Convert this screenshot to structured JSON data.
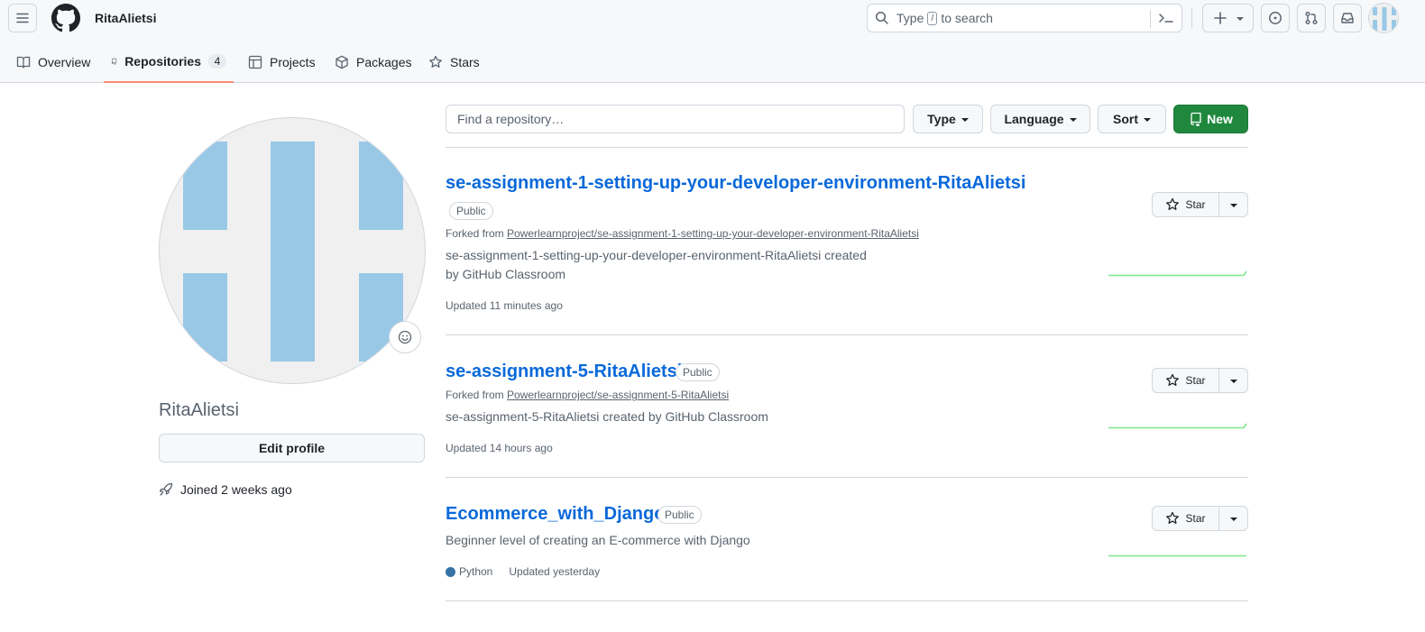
{
  "header": {
    "username": "RitaAlietsi",
    "search": {
      "prefix": "Type",
      "key": "/",
      "suffix": "to search"
    }
  },
  "tabs": [
    {
      "label": "Overview"
    },
    {
      "label": "Repositories",
      "count": "4"
    },
    {
      "label": "Projects"
    },
    {
      "label": "Packages"
    },
    {
      "label": "Stars"
    }
  ],
  "profile": {
    "name": "RitaAlietsi",
    "edit_label": "Edit profile",
    "joined": "Joined 2 weeks ago"
  },
  "toolbar": {
    "filter_placeholder": "Find a repository…",
    "type_label": "Type",
    "language_label": "Language",
    "sort_label": "Sort",
    "new_label": "New"
  },
  "repos": [
    {
      "name": "se-assignment-1-setting-up-your-developer-environment-RitaAlietsi",
      "visibility": "Public",
      "forked_prefix": "Forked from",
      "forked_from": "Powerlearnproject/se-assignment-1-setting-up-your-developer-environment-RitaAlietsi",
      "description_line1": "se-assignment-1-setting-up-your-developer-environment-RitaAlietsi created",
      "description_line2": "by GitHub Classroom",
      "updated": "Updated 11 minutes ago",
      "star_label": "Star"
    },
    {
      "name": "se-assignment-5-RitaAlietsi",
      "visibility": "Public",
      "forked_prefix": "Forked from",
      "forked_from": "Powerlearnproject/se-assignment-5-RitaAlietsi",
      "description_line1": "se-assignment-5-RitaAlietsi created by GitHub Classroom",
      "updated": "Updated 14 hours ago",
      "star_label": "Star"
    },
    {
      "name": "Ecommerce_with_Django",
      "visibility": "Public",
      "description_line1": "Beginner level of creating an E-commerce with Django",
      "language": "Python",
      "language_color": "#3572A5",
      "updated": "Updated yesterday",
      "star_label": "Star"
    }
  ],
  "colors": {
    "accent": "#0969da",
    "new_button": "#1f883d",
    "active_tab_underline": "#fd8c73",
    "sparkline": "#7ee787",
    "avatar_identicon": "#99c8e6"
  },
  "icons": [
    "hamburger-icon",
    "github-logo-icon",
    "search-icon",
    "command-palette-icon",
    "plus-icon",
    "issues-icon",
    "pull-request-icon",
    "inbox-icon",
    "book-icon",
    "repo-icon",
    "table-icon",
    "package-icon",
    "star-icon",
    "smiley-icon",
    "rocket-icon"
  ]
}
